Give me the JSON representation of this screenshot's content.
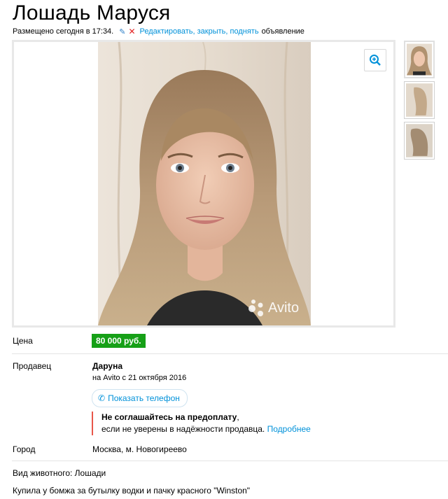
{
  "ad": {
    "title": "Лошадь Маруся",
    "posted": "Размещено сегодня в 17:34.",
    "manage_link": "Редактировать, закрыть, поднять",
    "manage_tail": "объявление"
  },
  "gallery": {
    "watermark": "Avito",
    "thumb_count": 3
  },
  "price": {
    "label": "Цена",
    "value": "80 000 руб."
  },
  "seller": {
    "label": "Продавец",
    "name": "Даруна",
    "since": "на Avito с 21 октября 2016",
    "phone_button": "Показать телефон",
    "warning_bold": "Не соглашайтесь на предоплату",
    "warning_comma": ",",
    "warning_rest": "если не уверены в надёжности продавца.",
    "warning_link": "Подробнее"
  },
  "city": {
    "label": "Город",
    "value": "Москва, м. Новогиреево"
  },
  "details": {
    "animal_type": "Вид животного: Лошади",
    "description": "Купила у бомжа за бутылку водки и пачку красного \"Winston\""
  },
  "colors": {
    "link": "#0091d9",
    "price_bg": "#16a017",
    "warning_bar": "#e8574a"
  },
  "icons": [
    "pencil-icon",
    "delete-x-icon",
    "zoom-in-icon",
    "phone-icon",
    "avito-logo-icon"
  ]
}
